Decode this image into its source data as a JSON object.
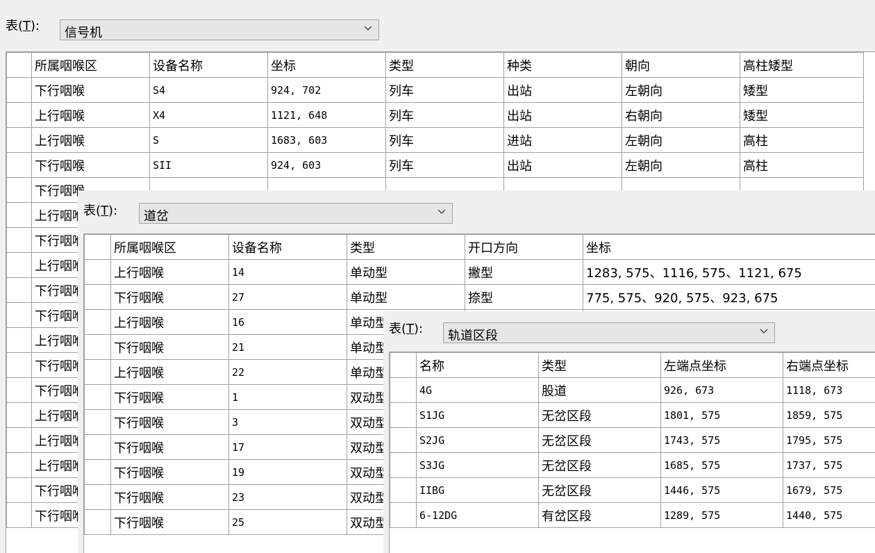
{
  "signal_panel": {
    "label_prefix": "表(",
    "label_key": "T",
    "label_suffix": "):",
    "selected_table": "信号机",
    "headers": [
      "所属咽喉区",
      "设备名称",
      "坐标",
      "类型",
      "种类",
      "朝向",
      "高柱矮型"
    ],
    "rows": [
      [
        "下行咽喉",
        "S4",
        "924, 702",
        "列车",
        "出站",
        "左朝向",
        "矮型"
      ],
      [
        "上行咽喉",
        "X4",
        "1121, 648",
        "列车",
        "出站",
        "右朝向",
        "矮型"
      ],
      [
        "上行咽喉",
        "S",
        "1683, 603",
        "列车",
        "进站",
        "左朝向",
        "高柱"
      ],
      [
        "下行咽喉",
        "SII",
        "924, 603",
        "列车",
        "出站",
        "左朝向",
        "高柱"
      ],
      [
        "下行咽喉",
        "",
        "",
        "",
        "",
        "",
        ""
      ],
      [
        "上行咽喉",
        "",
        "",
        "",
        "",
        "",
        ""
      ],
      [
        "下行咽喉",
        "",
        "",
        "",
        "",
        "",
        ""
      ],
      [
        "上行咽喉",
        "",
        "",
        "",
        "",
        "",
        ""
      ],
      [
        "下行咽喉",
        "",
        "",
        "",
        "",
        "",
        ""
      ],
      [
        "下行咽喉",
        "",
        "",
        "",
        "",
        "",
        ""
      ],
      [
        "上行咽喉",
        "",
        "",
        "",
        "",
        "",
        ""
      ],
      [
        "下行咽喉",
        "",
        "",
        "",
        "",
        "",
        ""
      ],
      [
        "下行咽喉",
        "",
        "",
        "",
        "",
        "",
        ""
      ],
      [
        "上行咽喉",
        "",
        "",
        "",
        "",
        "",
        ""
      ],
      [
        "上行咽喉",
        "",
        "",
        "",
        "",
        "",
        ""
      ],
      [
        "上行咽喉",
        "",
        "",
        "",
        "",
        "",
        ""
      ],
      [
        "下行咽喉",
        "",
        "",
        "",
        "",
        "",
        ""
      ],
      [
        "下行咽喉",
        "",
        "",
        "",
        "",
        "",
        ""
      ]
    ]
  },
  "switch_panel": {
    "label_prefix": "表(",
    "label_key": "T",
    "label_suffix": "):",
    "selected_table": "道岔",
    "headers": [
      "所属咽喉区",
      "设备名称",
      "类型",
      "开口方向",
      "坐标"
    ],
    "rows": [
      [
        "上行咽喉",
        "14",
        "单动型",
        "撇型",
        "1283, 575、1116, 575、1121, 675"
      ],
      [
        "下行咽喉",
        "27",
        "单动型",
        "捺型",
        "775, 575、920, 575、923, 675"
      ],
      [
        "上行咽喉",
        "16",
        "单动型",
        "",
        ""
      ],
      [
        "下行咽喉",
        "21",
        "单动型",
        "",
        ""
      ],
      [
        "上行咽喉",
        "22",
        "单动型",
        "",
        ""
      ],
      [
        "下行咽喉",
        "1",
        "双动型",
        "",
        ""
      ],
      [
        "下行咽喉",
        "3",
        "双动型",
        "",
        ""
      ],
      [
        "下行咽喉",
        "17",
        "双动型",
        "",
        ""
      ],
      [
        "下行咽喉",
        "19",
        "双动型",
        "",
        ""
      ],
      [
        "下行咽喉",
        "23",
        "双动型",
        "",
        ""
      ],
      [
        "下行咽喉",
        "25",
        "双动型",
        "",
        ""
      ]
    ]
  },
  "track_panel": {
    "label_prefix": "表(",
    "label_key": "T",
    "label_suffix": "):",
    "selected_table": "轨道区段",
    "headers": [
      "名称",
      "类型",
      "左端点坐标",
      "右端点坐标"
    ],
    "rows": [
      [
        "4G",
        "股道",
        "926, 673",
        "1118, 673"
      ],
      [
        "S1JG",
        "无岔区段",
        "1801, 575",
        "1859, 575"
      ],
      [
        "S2JG",
        "无岔区段",
        "1743, 575",
        "1795, 575"
      ],
      [
        "S3JG",
        "无岔区段",
        "1685, 575",
        "1737, 575"
      ],
      [
        "IIBG",
        "无岔区段",
        "1446, 575",
        "1679, 575"
      ],
      [
        "6-12DG",
        "有岔区段",
        "1289, 575",
        "1440, 575"
      ]
    ]
  },
  "icons": {
    "dropdown": "chevron-down-icon"
  }
}
